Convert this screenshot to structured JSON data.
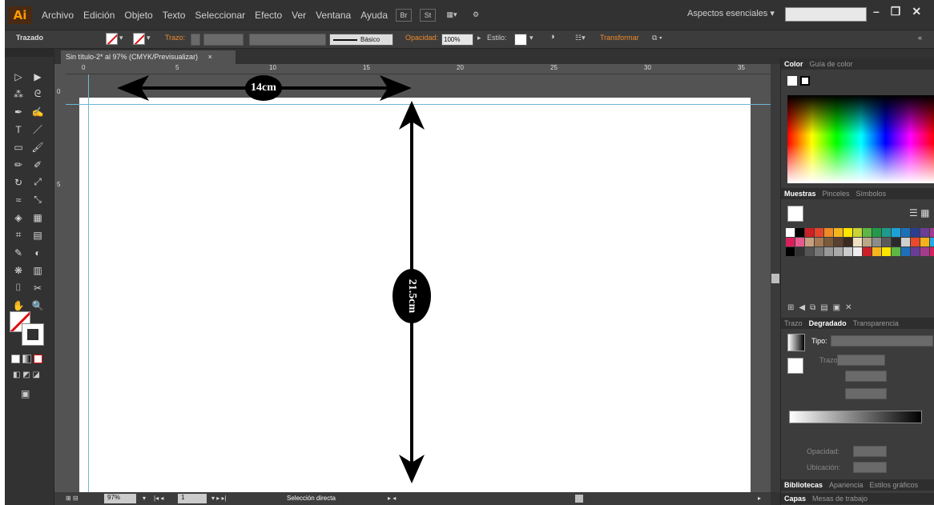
{
  "app": {
    "logo": "Ai"
  },
  "menubar": {
    "items": [
      "Archivo",
      "Edición",
      "Objeto",
      "Texto",
      "Seleccionar",
      "Efecto",
      "Ver",
      "Ventana",
      "Ayuda"
    ],
    "bridge_icon": "Br",
    "stock_icon": "St",
    "workspace": "Aspectos esenciales",
    "window_controls": [
      "–",
      "❐",
      "✕"
    ]
  },
  "controlbar": {
    "label": "Trazado",
    "stroke_label": "Trazo:",
    "brush_name": "Básico",
    "opacity_label": "Opacidad:",
    "opacity_value": "100%",
    "style_label": "Estilo:",
    "transform_label": "Transformar",
    "accent_color": "#ee8a2a",
    "panel_toggle": "«"
  },
  "document": {
    "tab_title": "Sin título-2* al 97% (CMYK/Previsualizar)",
    "tab_close": "×"
  },
  "rulers": {
    "horizontal_ticks": [
      "0",
      "5",
      "10",
      "15",
      "20",
      "25",
      "30",
      "35"
    ],
    "vertical_ticks": [
      "0",
      "5"
    ]
  },
  "annotations": {
    "width_label": "14cm",
    "height_label": "21.5cm"
  },
  "toolbox": {
    "icons": [
      "selection-icon",
      "direct-selection-icon",
      "magic-wand-icon",
      "lasso-icon",
      "pen-icon",
      "curvature-icon",
      "type-icon",
      "line-segment-icon",
      "rectangle-icon",
      "paintbrush-icon",
      "pencil-icon",
      "shaper-icon",
      "rotate-icon",
      "scale-icon",
      "width-icon",
      "free-transform-icon",
      "shape-builder-icon",
      "perspective-grid-icon",
      "mesh-icon",
      "gradient-icon",
      "eyedropper-icon",
      "blend-icon",
      "symbol-sprayer-icon",
      "column-graph-icon",
      "artboard-icon",
      "slice-icon",
      "hand-icon",
      "zoom-icon"
    ],
    "glyphs": [
      "▷",
      "▶",
      "⁂",
      "ᘓ",
      "✒",
      "✍",
      "T",
      "／",
      "▭",
      "🖌",
      "✏",
      "✐",
      "↻",
      "⤢",
      "≈",
      "⤡",
      "◈",
      "▦",
      "⌗",
      "▤",
      "✎",
      "◐",
      "❋",
      "▥",
      "⌷",
      "✂",
      "✋",
      "🔍"
    ]
  },
  "statusbar": {
    "zoom": "97%",
    "page": "1",
    "tool_name": "Selección directa"
  },
  "panels": {
    "color_tabs": [
      "Color",
      "Guía de color"
    ],
    "swatch_tabs": [
      "Muestras",
      "Pinceles",
      "Símbolos"
    ],
    "gradient_tabs": [
      "Trazo",
      "Degradado",
      "Transparencia"
    ],
    "gradient_type_label": "Tipo:",
    "gradient_stroke_label": "Trazo:",
    "opacity_label": "Opacidad:",
    "location_label": "Ubicación:",
    "bottom_tabs": [
      "Bibliotecas",
      "Apariencia",
      "Estilos gráficos"
    ],
    "layers_tabs": [
      "Capas",
      "Mesas de trabajo"
    ],
    "swatch_colors": [
      "#ffffff",
      "#000000",
      "#cc1f26",
      "#e4452a",
      "#f08a25",
      "#f5b61d",
      "#ffe600",
      "#c8d534",
      "#5db745",
      "#229a4a",
      "#1e9a8c",
      "#1ca0d8",
      "#1e6fb9",
      "#2c3e90",
      "#6a3d96",
      "#a43b8f",
      "#d81f5c",
      "#e85a8f",
      "#c6a080",
      "#a57a55",
      "#7b5a3c",
      "#5a4030",
      "#3a2a20",
      "#f0e0c0",
      "#bba888",
      "#8c8c8c",
      "#5a5a5a",
      "#2a2a2a",
      "#cfcfcf",
      "#e84a2a",
      "#f6b21b",
      "#29a9e0",
      "#000000",
      "#333333",
      "#555555",
      "#777777",
      "#999999",
      "#aaaaaa",
      "#cccccc",
      "#eeeeee",
      "#cc1f26",
      "#f5b61d",
      "#ffe600",
      "#5db745",
      "#1e6fb9",
      "#6a3d96",
      "#a43b8f",
      "#d81f5c"
    ]
  }
}
